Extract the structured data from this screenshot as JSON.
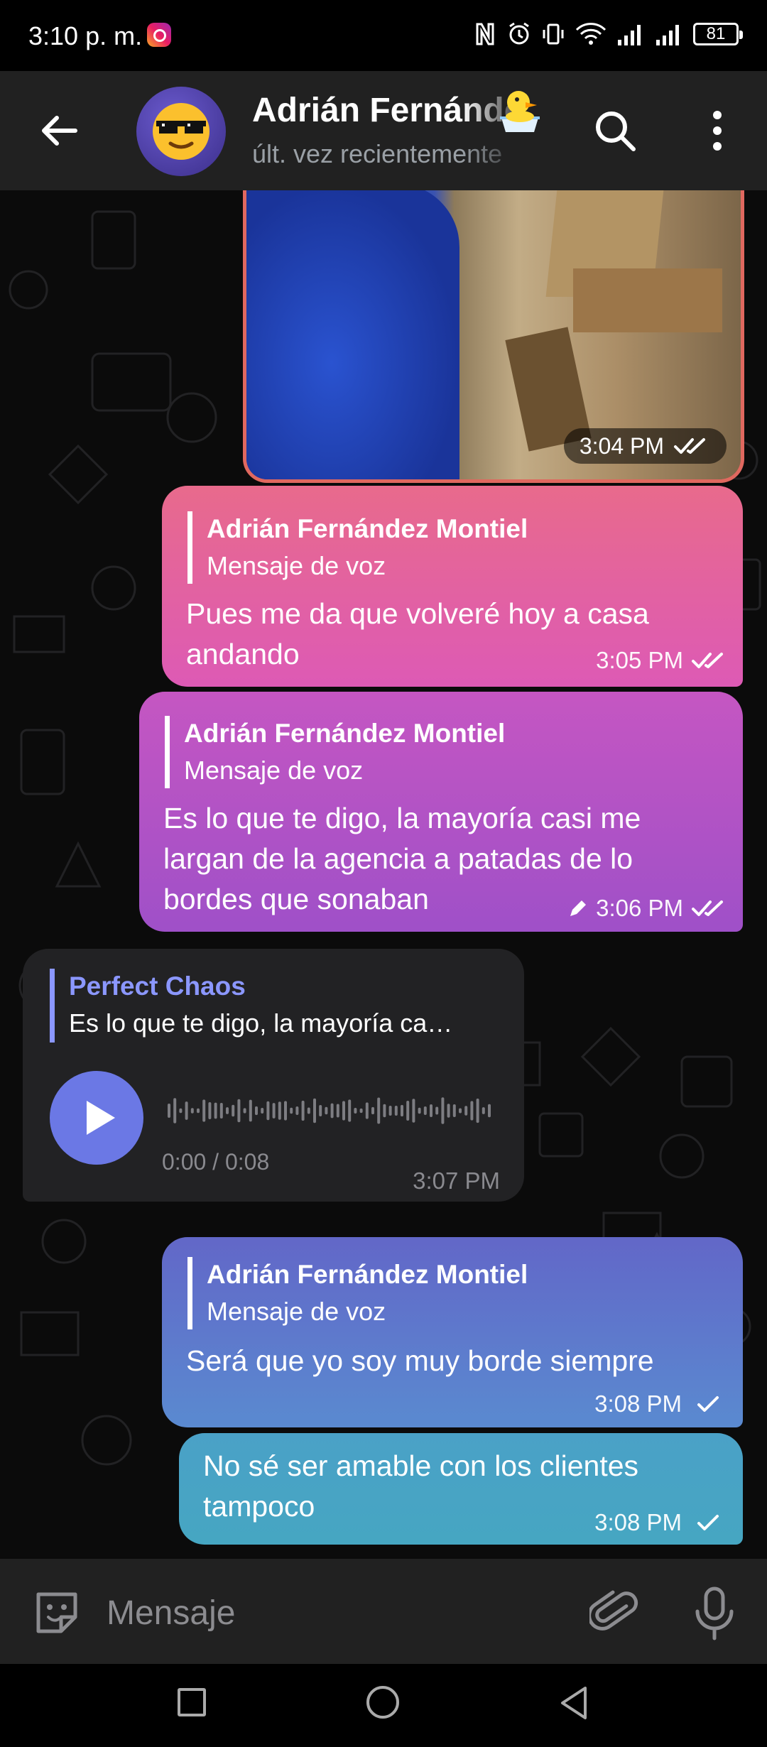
{
  "status_bar": {
    "time": "3:10 p. m.",
    "battery": "81"
  },
  "header": {
    "title": "Adrián Fernández Montiel",
    "subtitle": "últ. vez recientemente",
    "avatar_emoji": "😎"
  },
  "messages": {
    "photo": {
      "time": "3:04 PM"
    },
    "m1": {
      "reply_name": "Adrián Fernández Montiel",
      "reply_text": "Mensaje de voz",
      "text_line1": "Pues me da que volveré hoy a casa",
      "text_line2": "andando",
      "time": "3:05 PM"
    },
    "m2": {
      "reply_name": "Adrián Fernández Montiel",
      "reply_text": "Mensaje de voz",
      "text_line1": "Es lo que te digo, la mayoría casi me",
      "text_line2": "largan de la agencia a patadas de lo",
      "text_line3": "bordes que sonaban",
      "time": "3:06 PM"
    },
    "m3": {
      "reply_name": "Perfect Chaos",
      "reply_text": "Es lo que te digo, la mayoría ca…",
      "duration": "0:00 / 0:08",
      "time": "3:07 PM"
    },
    "m4": {
      "reply_name": "Adrián Fernández Montiel",
      "reply_text": "Mensaje de voz",
      "text": "Será que yo soy muy borde siempre",
      "time": "3:08 PM"
    },
    "m5": {
      "text_line1": "No sé ser amable con los clientes",
      "text_line2": "tampoco",
      "time": "3:08 PM"
    }
  },
  "input": {
    "placeholder": "Mensaje"
  },
  "colors": {
    "header_bg": "#212121",
    "accent": "#6b78e5"
  },
  "icons": [
    "instagram-icon",
    "nfc-icon",
    "alarm-icon",
    "vibrate-icon",
    "wifi-icon",
    "signal-icon",
    "battery-icon",
    "back-arrow-icon",
    "search-icon",
    "more-vert-icon",
    "duck-emoji-icon",
    "double-check-icon",
    "single-check-icon",
    "edit-pencil-icon",
    "play-icon",
    "emoji-sticker-icon",
    "paperclip-icon",
    "microphone-icon",
    "nav-recent-icon",
    "nav-home-icon",
    "nav-back-icon"
  ]
}
